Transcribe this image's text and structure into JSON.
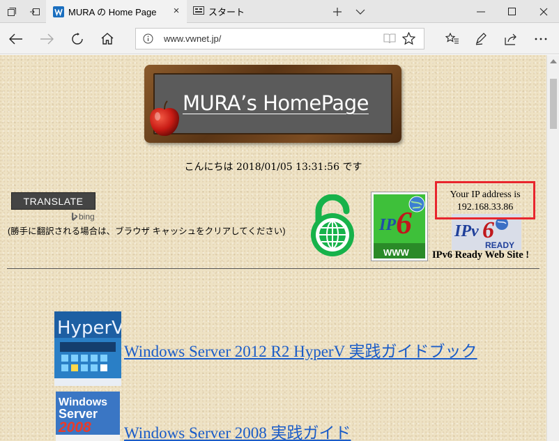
{
  "browser": {
    "tabs": [
      {
        "title": "MURA の Home Page",
        "active": true
      },
      {
        "title": "スタート",
        "active": false
      }
    ],
    "address": {
      "url": "www.vwnet.jp/"
    }
  },
  "page": {
    "banner_title": "MURA’s HomePage",
    "greeting": "こんにちは 2018/01/05 13:31:56 です",
    "translate": {
      "button_label": "TRANSLATE",
      "bing_label": "bing",
      "note": "(勝手に翻訳される場合は、ブラウザ キャッシュをクリアしてください)"
    },
    "ip_box": {
      "line1": "Your IP address is",
      "line2": "192.168.33.86"
    },
    "ipv6_ready_text": "IPv6 Ready Web Site !",
    "badges": {
      "ipv6_www_label": "WWW",
      "ipv6_ready_label": "READY"
    },
    "books": [
      {
        "title": "Windows Server 2012 R2 HyperV 実践ガイドブック",
        "cover_text": "HyperV"
      },
      {
        "title": "Windows Server 2008 実践ガイド",
        "cover_text_1": "Windows",
        "cover_text_2": "Server",
        "cover_text_3": "2008"
      }
    ]
  },
  "colors": {
    "page_bg": "#eee2c4",
    "link": "#1a5cc8",
    "ip_box_border": "#e8262d",
    "lock_green": "#17b24a"
  }
}
